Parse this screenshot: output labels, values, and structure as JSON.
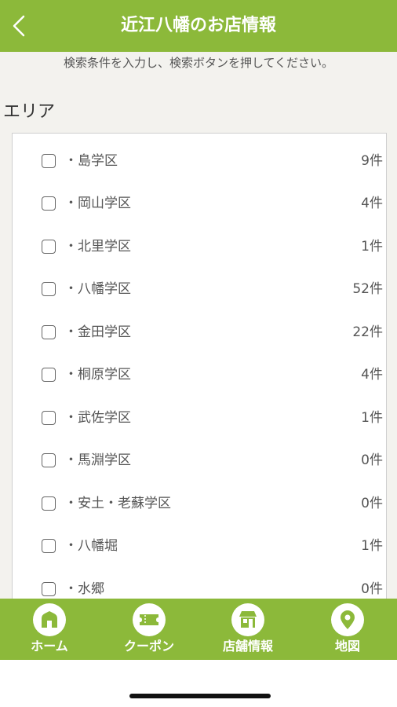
{
  "header": {
    "title": "近江八幡のお店情報"
  },
  "instruction": "検索条件を入力し、検索ボタンを押してください。",
  "area_section": {
    "title": "エリア",
    "items": [
      {
        "label": "・島学区",
        "count": "9件"
      },
      {
        "label": "・岡山学区",
        "count": "4件"
      },
      {
        "label": "・北里学区",
        "count": "1件"
      },
      {
        "label": "・八幡学区",
        "count": "52件"
      },
      {
        "label": "・金田学区",
        "count": "22件"
      },
      {
        "label": "・桐原学区",
        "count": "4件"
      },
      {
        "label": "・武佐学区",
        "count": "1件"
      },
      {
        "label": "・馬淵学区",
        "count": "0件"
      },
      {
        "label": "・安土・老蘇学区",
        "count": "0件"
      },
      {
        "label": "・八幡堀",
        "count": "1件"
      },
      {
        "label": "・水郷",
        "count": "0件"
      }
    ]
  },
  "tabbar": {
    "tabs": [
      {
        "label": "ホーム",
        "icon": "home-icon"
      },
      {
        "label": "クーポン",
        "icon": "coupon-icon"
      },
      {
        "label": "店舗情報",
        "icon": "store-icon"
      },
      {
        "label": "地図",
        "icon": "map-pin-icon"
      }
    ]
  },
  "colors": {
    "accent": "#8cb93a",
    "background": "#f3f2ee"
  }
}
